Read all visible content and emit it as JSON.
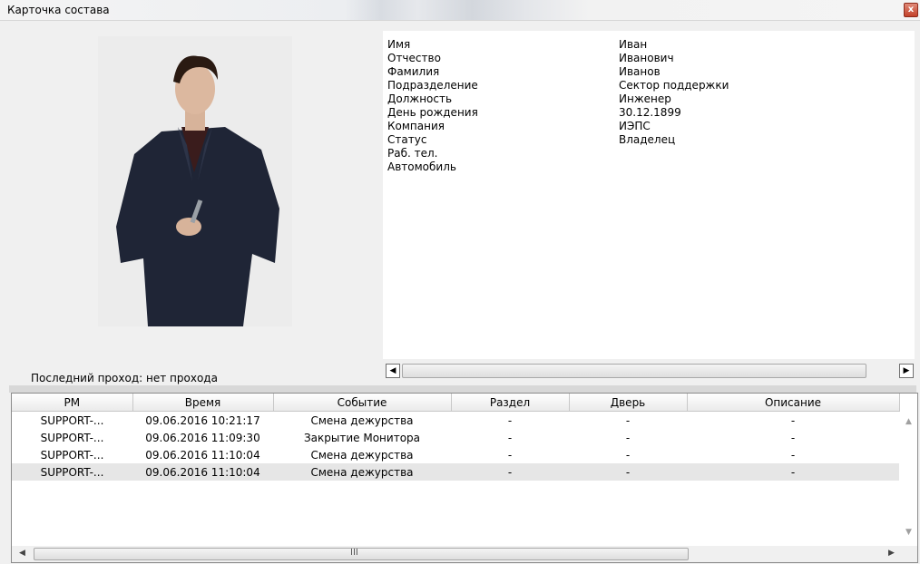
{
  "window": {
    "title": "Карточка состава",
    "close_label": "x"
  },
  "photo": {
    "alt_icon": "person-photo"
  },
  "last_pass": {
    "label": "Последний проход:",
    "value": "нет прохода"
  },
  "info": [
    {
      "label": "Имя",
      "value": "Иван"
    },
    {
      "label": "Отчество",
      "value": "Иванович"
    },
    {
      "label": "Фамилия",
      "value": "Иванов"
    },
    {
      "label": "Подразделение",
      "value": "Сектор поддержки"
    },
    {
      "label": "Должность",
      "value": "Инженер"
    },
    {
      "label": "День рождения",
      "value": "30.12.1899"
    },
    {
      "label": "Компания",
      "value": "ИЭПС"
    },
    {
      "label": "Статус",
      "value": "Владелец"
    },
    {
      "label": "Раб. тел.",
      "value": ""
    },
    {
      "label": "Автомобиль",
      "value": ""
    }
  ],
  "scroll": {
    "left": "◀",
    "right": "▶",
    "up": "▲",
    "down": "▼",
    "grip": "III"
  },
  "table": {
    "columns": [
      "РМ",
      "Время",
      "Событие",
      "Раздел",
      "Дверь",
      "Описание"
    ],
    "rows": [
      [
        "SUPPORT-...",
        "09.06.2016 10:21:17",
        "Смена дежурства",
        "-",
        "-",
        "-"
      ],
      [
        "SUPPORT-...",
        "09.06.2016 11:09:30",
        "Закрытие Монитора",
        "-",
        "-",
        "-"
      ],
      [
        "SUPPORT-...",
        "09.06.2016 11:10:04",
        "Смена дежурства",
        "-",
        "-",
        "-"
      ],
      [
        "SUPPORT-...",
        "09.06.2016 11:10:04",
        "Смена дежурства",
        "-",
        "-",
        "-"
      ]
    ],
    "selected_row": 3
  }
}
